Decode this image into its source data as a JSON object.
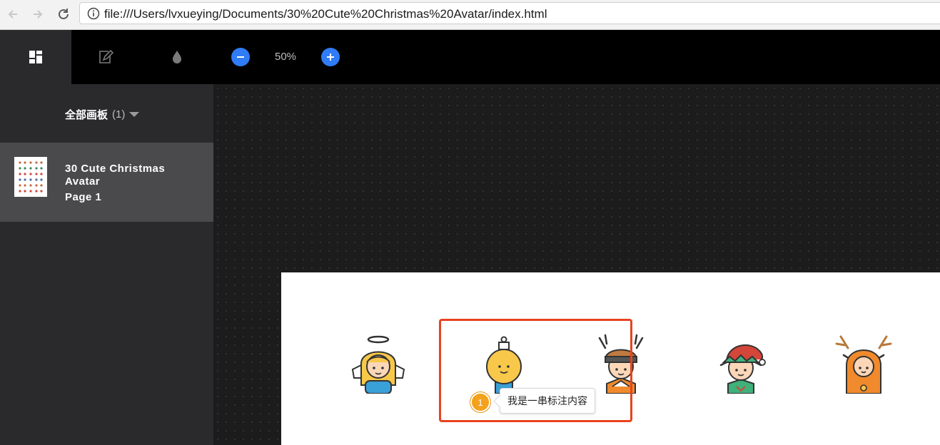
{
  "browser": {
    "url": "file:///Users/lvxueying/Documents/30%20Cute%20Christmas%20Avatar/index.html"
  },
  "toolbar": {
    "zoom_level": "50%",
    "tabs": [
      {
        "icon": "artboards-grid-icon",
        "active": true
      },
      {
        "icon": "annotate-pen-icon",
        "active": false
      },
      {
        "icon": "color-drop-icon",
        "active": false
      }
    ]
  },
  "sidebar": {
    "header_label": "全部画板",
    "header_count": "(1)",
    "artboards": [
      {
        "title": "30 Cute Christmas Avatar",
        "page": "Page 1",
        "selected": true
      }
    ]
  },
  "canvas": {
    "avatars": [
      "angel-avatar",
      "ornament-avatar",
      "reindeer-hat-boy-avatar",
      "elf-avatar",
      "reindeer-costume-avatar"
    ],
    "annotation": {
      "number": "1",
      "text": "我是一串标注内容"
    }
  },
  "colors": {
    "accent_blue": "#2f7cf6",
    "selection_red": "#e8431f",
    "marker_orange": "#f4a11c",
    "sidebar_bg": "#2a2a2d",
    "sidebar_selected": "#4a4a4d"
  }
}
